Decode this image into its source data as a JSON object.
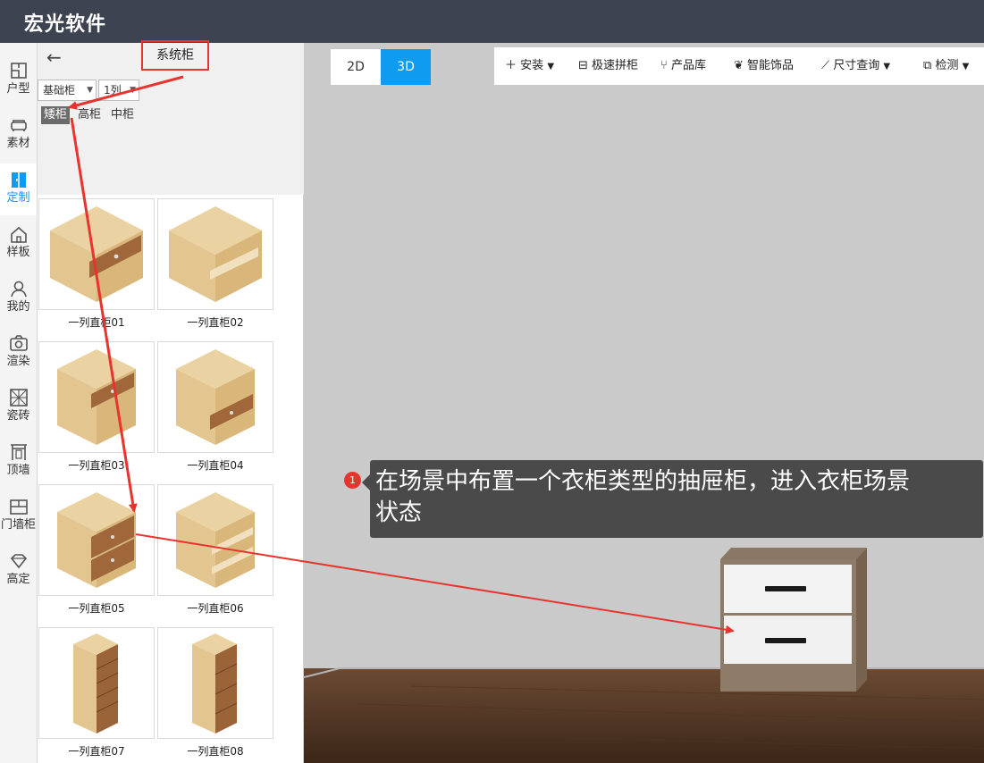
{
  "app": {
    "title": "宏光软件"
  },
  "leftrail": {
    "items": [
      {
        "label": "户型",
        "icon": "floorplan-icon"
      },
      {
        "label": "素材",
        "icon": "sofa-icon"
      },
      {
        "label": "定制",
        "icon": "cabinet-icon"
      },
      {
        "label": "样板",
        "icon": "house-icon"
      },
      {
        "label": "我的",
        "icon": "user-icon"
      },
      {
        "label": "渲染",
        "icon": "camera-icon"
      },
      {
        "label": "瓷砖",
        "icon": "tile-icon"
      },
      {
        "label": "顶墙",
        "icon": "ceiling-icon"
      },
      {
        "label": "门墙柜",
        "icon": "door-cabinet-icon"
      },
      {
        "label": "高定",
        "icon": "diamond-icon"
      }
    ],
    "active_index": 2
  },
  "panel": {
    "back_icon": "←",
    "title": "系统柜",
    "select1": "基础柜",
    "select2": "1列",
    "subtabs": [
      "矮柜",
      "高柜",
      "中柜"
    ],
    "active_subtab": 0,
    "items": [
      {
        "name": "一列直柜01"
      },
      {
        "name": "一列直柜02"
      },
      {
        "name": "一列直柜03"
      },
      {
        "name": "一列直柜04"
      },
      {
        "name": "一列直柜05"
      },
      {
        "name": "一列直柜06"
      },
      {
        "name": "一列直柜07"
      },
      {
        "name": "一列直柜08"
      }
    ]
  },
  "view": {
    "toggle_2d": "2D",
    "toggle_3d": "3D",
    "active_mode": "3D",
    "toolbar": [
      {
        "label": "安装",
        "icon": "plus-icon",
        "dropdown": true
      },
      {
        "label": "极速拼柜",
        "icon": "split-cabinet-icon",
        "dropdown": false
      },
      {
        "label": "产品库",
        "icon": "product-icon",
        "dropdown": false
      },
      {
        "label": "智能饰品",
        "icon": "decor-icon",
        "dropdown": false
      },
      {
        "label": "尺寸查询",
        "icon": "ruler-icon",
        "dropdown": true
      },
      {
        "label": "检测",
        "icon": "detect-icon",
        "dropdown": true
      }
    ]
  },
  "annotation": {
    "badge": "1",
    "text_line1": "在场景中布置一个衣柜类型的抽屉柜，进入衣柜场景",
    "text_line2": "状态"
  },
  "colors": {
    "accent": "#0f9bf0",
    "titlebar": "#3d4350",
    "highlight": "#e8342f"
  }
}
